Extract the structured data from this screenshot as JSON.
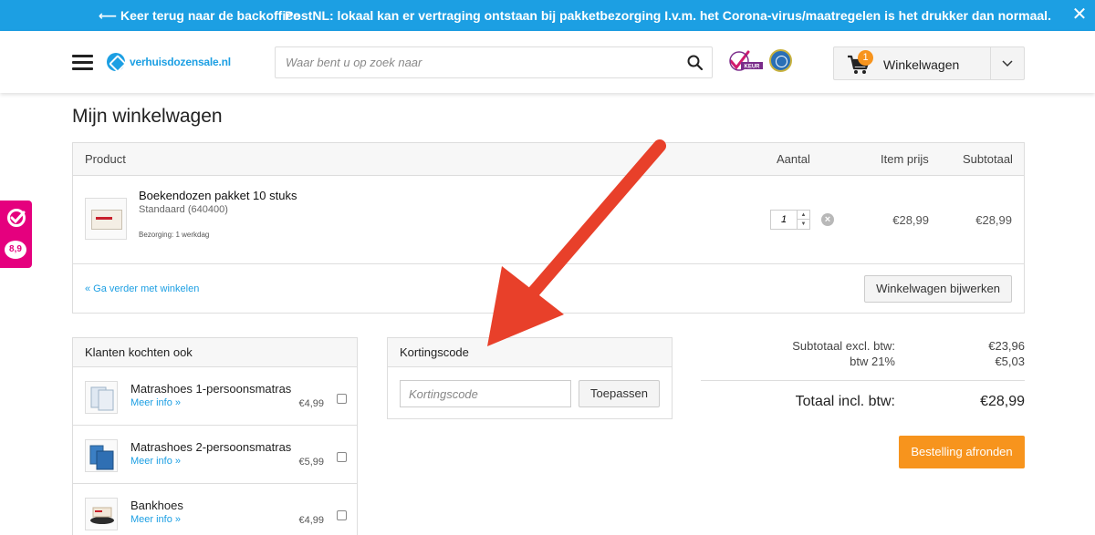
{
  "notice": {
    "back_link": "⟵ Keer terug naar de backoffice",
    "message": "PostNL: lokaal kan er vertraging ontstaan bij pakketbezorging I.v.m. het Corona-virus/maatregelen is het drukker dan normaal.",
    "close_icon": "close-icon"
  },
  "header": {
    "logo_text": "verhuisdozensale.nl",
    "search_placeholder": "Waar bent u op zoek naar",
    "badge_keur_text": "KEUR",
    "cart_count": "1",
    "cart_label": "Winkelwagen"
  },
  "side_widget": {
    "score": "8,9"
  },
  "page": {
    "title": "Mijn winkelwagen"
  },
  "cart": {
    "columns": {
      "product": "Product",
      "quantity": "Aantal",
      "item_price": "Item prijs",
      "subtotal": "Subtotaal"
    },
    "items": [
      {
        "name": "Boekendozen pakket 10 stuks",
        "variant": "Standaard (640400)",
        "delivery": "Bezorging: 1 werkdag",
        "quantity": "1",
        "item_price": "€28,99",
        "subtotal": "€28,99"
      }
    ],
    "continue_link": "« Ga verder met winkelen",
    "update_button": "Winkelwagen bijwerken"
  },
  "also_bought": {
    "title": "Klanten kochten ook",
    "items": [
      {
        "name": "Matrashoes 1-persoonsmatras",
        "more": "Meer info »",
        "price": "€4,99"
      },
      {
        "name": "Matrashoes 2-persoonsmatras",
        "more": "Meer info »",
        "price": "€5,99"
      },
      {
        "name": "Bankhoes",
        "more": "Meer info »",
        "price": "€4,99"
      }
    ]
  },
  "coupon": {
    "title": "Kortingscode",
    "placeholder": "Kortingscode",
    "apply_button": "Toepassen"
  },
  "totals": {
    "subtotal_excl_label": "Subtotaal excl. btw:",
    "subtotal_excl_value": "€23,96",
    "vat_label": "btw 21%",
    "vat_value": "€5,03",
    "total_label": "Totaal incl. btw:",
    "total_value": "€28,99",
    "checkout_button": "Bestelling afronden"
  },
  "colors": {
    "brand_blue": "#1c9fe3",
    "accent_orange": "#f7941d",
    "annotation_red": "#e8402a",
    "widget_pink": "#e5007e"
  }
}
